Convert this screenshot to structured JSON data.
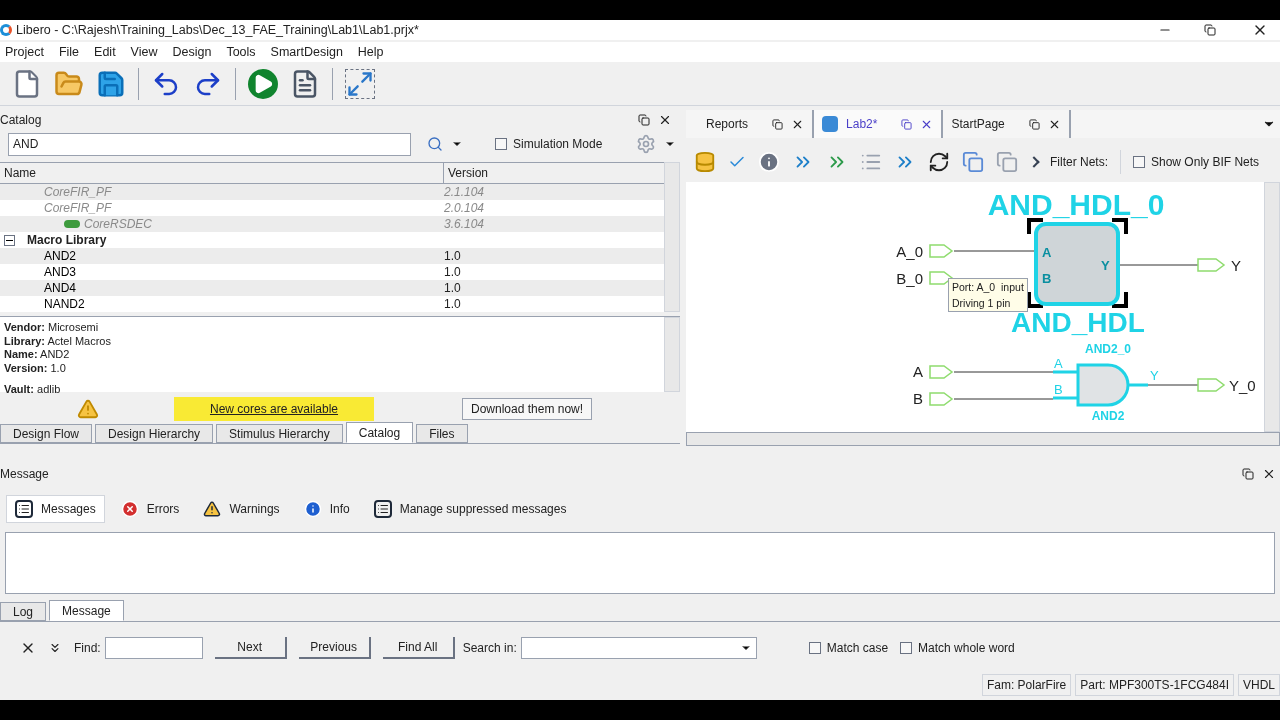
{
  "window": {
    "title": "Libero - C:\\Rajesh\\Training_Labs\\Dec_13_FAE_Training\\Lab1\\Lab1.prjx*"
  },
  "menu": [
    "Project",
    "File",
    "Edit",
    "View",
    "Design",
    "Tools",
    "SmartDesign",
    "Help"
  ],
  "catalog": {
    "title": "Catalog",
    "search": "AND",
    "simulation_mode": {
      "label": "Simulation Mode",
      "checked": false
    },
    "columns": [
      "Name",
      "Version"
    ],
    "rows": [
      {
        "name": "CoreFIR_PF",
        "version": "2.1.104",
        "disabled": true
      },
      {
        "name": "CoreFIR_PF",
        "version": "2.0.104",
        "disabled": true
      },
      {
        "name": "CoreRSDEC",
        "version": "3.6.104",
        "disabled": true,
        "licensed": true
      },
      {
        "name": "Macro Library",
        "expanded": true,
        "children": [
          {
            "name": "AND2",
            "version": "1.0",
            "disabled": false
          },
          {
            "name": "AND3",
            "version": "1.0",
            "disabled": false
          },
          {
            "name": "AND4",
            "version": "1.0",
            "disabled": false
          },
          {
            "name": "NAND2",
            "version": "1.0",
            "disabled": false
          }
        ]
      }
    ],
    "details": [
      "**Vendor:** Microsemi",
      "**Library:** Actel Macros",
      "**Name:** AND2",
      "**Version:** 1.0",
      "**Vault:** adlib"
    ],
    "notice": "New cores are available",
    "download_button": "Download them now!",
    "tabs": [
      {
        "label": "Design Flow",
        "selected": false
      },
      {
        "label": "Design Hierarchy",
        "selected": false
      },
      {
        "label": "Stimulus Hierarchy",
        "selected": false
      },
      {
        "label": "Catalog",
        "selected": true
      },
      {
        "label": "Files",
        "selected": false
      }
    ]
  },
  "documents": {
    "tabs": [
      {
        "label": "Reports",
        "selected": false
      },
      {
        "label": "Lab2*",
        "selected": true
      },
      {
        "label": "StartPage",
        "selected": false
      }
    ],
    "filter_label": "Filter Nets:",
    "bif_only": {
      "label": "Show Only BIF Nets",
      "checked": false
    },
    "schematic": {
      "block_title": "AND_HDL_0",
      "block_type": "AND_HDL",
      "block_pins": [
        "A",
        "B",
        "Y"
      ],
      "block_inputs": [
        "A_0",
        "B_0"
      ],
      "block_output": "Y",
      "tooltip": [
        "Port: A_0  input",
        "Driving 1 pin"
      ],
      "gate_title": "AND2_0",
      "gate_type": "AND2",
      "gate_pins": [
        "A",
        "B",
        "Y"
      ],
      "gate_inputs": [
        "A",
        "B"
      ],
      "gate_output": "Y_0"
    }
  },
  "messages": {
    "title": "Message",
    "filters": [
      {
        "label": "Messages",
        "selected": true,
        "kind": "list"
      },
      {
        "label": "Errors",
        "selected": false,
        "kind": "error"
      },
      {
        "label": "Warnings",
        "selected": false,
        "kind": "warning"
      },
      {
        "label": "Info",
        "selected": false,
        "kind": "info"
      },
      {
        "label": "Manage suppressed messages",
        "selected": false,
        "kind": "list"
      }
    ],
    "tabs": [
      {
        "label": "Log",
        "selected": false
      },
      {
        "label": "Message",
        "selected": true
      }
    ]
  },
  "find": {
    "find_label": "Find:",
    "buttons": [
      "Next",
      "Previous",
      "Find All"
    ],
    "search_in_label": "Search in:",
    "match_case": {
      "label": "Match case",
      "checked": false
    },
    "match_whole_word": {
      "label": "Match whole word",
      "checked": false
    }
  },
  "status_bar": [
    "Fam: PolarFire",
    "Part: MPF300TS-1FCG484I",
    "VHDL"
  ]
}
